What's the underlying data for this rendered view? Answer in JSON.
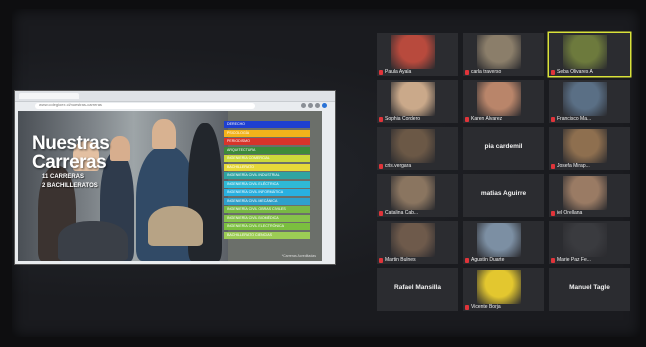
{
  "shared_screen": {
    "url": "www.colegioex.cl/nuestras-carreras",
    "slide": {
      "title_line1": "Nuestras",
      "title_line2": "Carreras",
      "subtitle_line1": "11 CARRERAS",
      "subtitle_line2": "2 BACHILLERATOS",
      "careers": [
        {
          "label": "DERECHO",
          "color": "#1e3fd0"
        },
        {
          "label": "PSICOLOGÍA",
          "color": "#f2b31b"
        },
        {
          "label": "PERIODISMO",
          "color": "#d8342a"
        },
        {
          "label": "ARQUITECTURA",
          "color": "#3d8a3a"
        },
        {
          "label": "INGENIERÍA COMERCIAL",
          "color": "#cbd93b"
        },
        {
          "label": "BACHILLERATO",
          "color": "#e6d83a"
        },
        {
          "label": "INGENIERÍA CIVIL INDUSTRIAL",
          "color": "#2fa4a2"
        },
        {
          "label": "INGENIERÍA CIVIL ELÉCTRICA",
          "color": "#2fb9d6"
        },
        {
          "label": "INGENIERÍA CIVIL INFORMÁTICA",
          "color": "#29b0e0"
        },
        {
          "label": "INGENIERÍA CIVIL MECÁNICA",
          "color": "#2ea0cc"
        },
        {
          "label": "INGENIERÍA CIVIL OBRAS CIVILES",
          "color": "#78b844"
        },
        {
          "label": "INGENIERÍA CIVIL BIOMÉDICA",
          "color": "#86c24a"
        },
        {
          "label": "INGENIERÍA CIVIL ELECTRÓNICA",
          "color": "#7bbf3f"
        },
        {
          "label": "BACHILLERATO CIENCIAS",
          "color": "#9ccc55"
        }
      ],
      "footnote": "*Carreras Acreditadas"
    }
  },
  "participants": [
    {
      "name": "Paula Ayala",
      "cam": "#b84a3d",
      "active": false
    },
    {
      "name": "carla traverso",
      "cam": "#8b7e6a",
      "active": false
    },
    {
      "name": "Seba Olivares A",
      "cam": "#6d7a3d",
      "active": true
    },
    {
      "name": "Sophia Cordero",
      "cam": "#caa98a",
      "active": false
    },
    {
      "name": "Karen Alvarez",
      "cam": "#b9856a",
      "active": false
    },
    {
      "name": "Francisco Ma...",
      "cam": "#5a6f85",
      "active": false
    },
    {
      "name": "cris.vergara",
      "cam": "#6b5846",
      "active": false
    },
    {
      "name": "pia cardemil",
      "cam": "",
      "active": false
    },
    {
      "name": "Josefa Mirap...",
      "cam": "#8e6f4f",
      "active": false
    },
    {
      "name": "Catalina Cab...",
      "cam": "#8a7560",
      "active": false
    },
    {
      "name": "matias Aguirre",
      "cam": "",
      "active": false
    },
    {
      "name": "iel Orellana",
      "cam": "#9a7b64",
      "active": false
    },
    {
      "name": "Martin Bulnes",
      "cam": "#6e5a4b",
      "active": false
    },
    {
      "name": "Agustín Duarte",
      "cam": "#7c8fa3",
      "active": false
    },
    {
      "name": "Marie Paz Fe...",
      "cam": "#3a3b3f",
      "active": false
    },
    {
      "name": "Rafael Mansilla",
      "cam": "",
      "active": false
    },
    {
      "name": "Vicente Borja",
      "cam": "#e3c72f",
      "active": false
    },
    {
      "name": "Manuel Tagle",
      "cam": "",
      "active": false
    }
  ]
}
